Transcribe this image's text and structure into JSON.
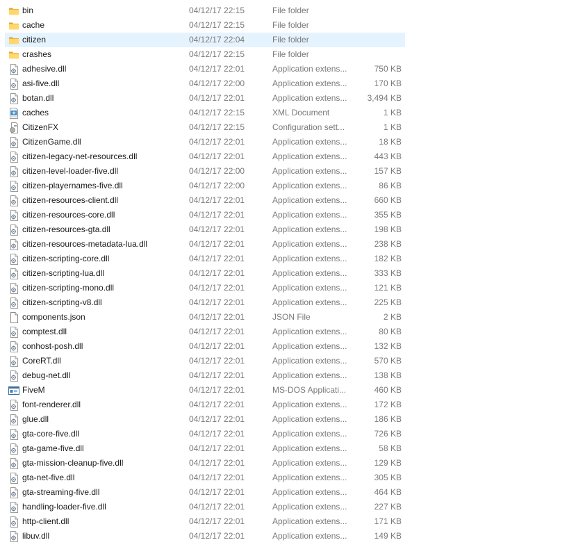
{
  "files": [
    {
      "name": "bin",
      "date": "04/12/17 22:15",
      "type": "File folder",
      "size": "",
      "icon": "folder-icon"
    },
    {
      "name": "cache",
      "date": "04/12/17 22:15",
      "type": "File folder",
      "size": "",
      "icon": "folder-icon"
    },
    {
      "name": "citizen",
      "date": "04/12/17 22:04",
      "type": "File folder",
      "size": "",
      "icon": "folder-icon",
      "selected": true
    },
    {
      "name": "crashes",
      "date": "04/12/17 22:15",
      "type": "File folder",
      "size": "",
      "icon": "folder-icon"
    },
    {
      "name": "adhesive.dll",
      "date": "04/12/17 22:01",
      "type": "Application extens...",
      "size": "750 KB",
      "icon": "dll-icon"
    },
    {
      "name": "asi-five.dll",
      "date": "04/12/17 22:00",
      "type": "Application extens...",
      "size": "170 KB",
      "icon": "dll-icon"
    },
    {
      "name": "botan.dll",
      "date": "04/12/17 22:01",
      "type": "Application extens...",
      "size": "3,494 KB",
      "icon": "dll-icon"
    },
    {
      "name": "caches",
      "date": "04/12/17 22:15",
      "type": "XML Document",
      "size": "1 KB",
      "icon": "xml-icon"
    },
    {
      "name": "CitizenFX",
      "date": "04/12/17 22:15",
      "type": "Configuration sett...",
      "size": "1 KB",
      "icon": "config-icon"
    },
    {
      "name": "CitizenGame.dll",
      "date": "04/12/17 22:01",
      "type": "Application extens...",
      "size": "18 KB",
      "icon": "dll-icon"
    },
    {
      "name": "citizen-legacy-net-resources.dll",
      "date": "04/12/17 22:01",
      "type": "Application extens...",
      "size": "443 KB",
      "icon": "dll-icon"
    },
    {
      "name": "citizen-level-loader-five.dll",
      "date": "04/12/17 22:00",
      "type": "Application extens...",
      "size": "157 KB",
      "icon": "dll-icon"
    },
    {
      "name": "citizen-playernames-five.dll",
      "date": "04/12/17 22:00",
      "type": "Application extens...",
      "size": "86 KB",
      "icon": "dll-icon"
    },
    {
      "name": "citizen-resources-client.dll",
      "date": "04/12/17 22:01",
      "type": "Application extens...",
      "size": "660 KB",
      "icon": "dll-icon"
    },
    {
      "name": "citizen-resources-core.dll",
      "date": "04/12/17 22:01",
      "type": "Application extens...",
      "size": "355 KB",
      "icon": "dll-icon"
    },
    {
      "name": "citizen-resources-gta.dll",
      "date": "04/12/17 22:01",
      "type": "Application extens...",
      "size": "198 KB",
      "icon": "dll-icon"
    },
    {
      "name": "citizen-resources-metadata-lua.dll",
      "date": "04/12/17 22:01",
      "type": "Application extens...",
      "size": "238 KB",
      "icon": "dll-icon"
    },
    {
      "name": "citizen-scripting-core.dll",
      "date": "04/12/17 22:01",
      "type": "Application extens...",
      "size": "182 KB",
      "icon": "dll-icon"
    },
    {
      "name": "citizen-scripting-lua.dll",
      "date": "04/12/17 22:01",
      "type": "Application extens...",
      "size": "333 KB",
      "icon": "dll-icon"
    },
    {
      "name": "citizen-scripting-mono.dll",
      "date": "04/12/17 22:01",
      "type": "Application extens...",
      "size": "121 KB",
      "icon": "dll-icon"
    },
    {
      "name": "citizen-scripting-v8.dll",
      "date": "04/12/17 22:01",
      "type": "Application extens...",
      "size": "225 KB",
      "icon": "dll-icon"
    },
    {
      "name": "components.json",
      "date": "04/12/17 22:01",
      "type": "JSON File",
      "size": "2 KB",
      "icon": "file-icon"
    },
    {
      "name": "comptest.dll",
      "date": "04/12/17 22:01",
      "type": "Application extens...",
      "size": "80 KB",
      "icon": "dll-icon"
    },
    {
      "name": "conhost-posh.dll",
      "date": "04/12/17 22:01",
      "type": "Application extens...",
      "size": "132 KB",
      "icon": "dll-icon"
    },
    {
      "name": "CoreRT.dll",
      "date": "04/12/17 22:01",
      "type": "Application extens...",
      "size": "570 KB",
      "icon": "dll-icon"
    },
    {
      "name": "debug-net.dll",
      "date": "04/12/17 22:01",
      "type": "Application extens...",
      "size": "138 KB",
      "icon": "dll-icon"
    },
    {
      "name": "FiveM",
      "date": "04/12/17 22:01",
      "type": "MS-DOS Applicati...",
      "size": "460 KB",
      "icon": "exe-icon"
    },
    {
      "name": "font-renderer.dll",
      "date": "04/12/17 22:01",
      "type": "Application extens...",
      "size": "172 KB",
      "icon": "dll-icon"
    },
    {
      "name": "glue.dll",
      "date": "04/12/17 22:01",
      "type": "Application extens...",
      "size": "186 KB",
      "icon": "dll-icon"
    },
    {
      "name": "gta-core-five.dll",
      "date": "04/12/17 22:01",
      "type": "Application extens...",
      "size": "726 KB",
      "icon": "dll-icon"
    },
    {
      "name": "gta-game-five.dll",
      "date": "04/12/17 22:01",
      "type": "Application extens...",
      "size": "58 KB",
      "icon": "dll-icon"
    },
    {
      "name": "gta-mission-cleanup-five.dll",
      "date": "04/12/17 22:01",
      "type": "Application extens...",
      "size": "129 KB",
      "icon": "dll-icon"
    },
    {
      "name": "gta-net-five.dll",
      "date": "04/12/17 22:01",
      "type": "Application extens...",
      "size": "305 KB",
      "icon": "dll-icon"
    },
    {
      "name": "gta-streaming-five.dll",
      "date": "04/12/17 22:01",
      "type": "Application extens...",
      "size": "464 KB",
      "icon": "dll-icon"
    },
    {
      "name": "handling-loader-five.dll",
      "date": "04/12/17 22:01",
      "type": "Application extens...",
      "size": "227 KB",
      "icon": "dll-icon"
    },
    {
      "name": "http-client.dll",
      "date": "04/12/17 22:01",
      "type": "Application extens...",
      "size": "171 KB",
      "icon": "dll-icon"
    },
    {
      "name": "libuv.dll",
      "date": "04/12/17 22:01",
      "type": "Application extens...",
      "size": "149 KB",
      "icon": "dll-icon"
    }
  ]
}
